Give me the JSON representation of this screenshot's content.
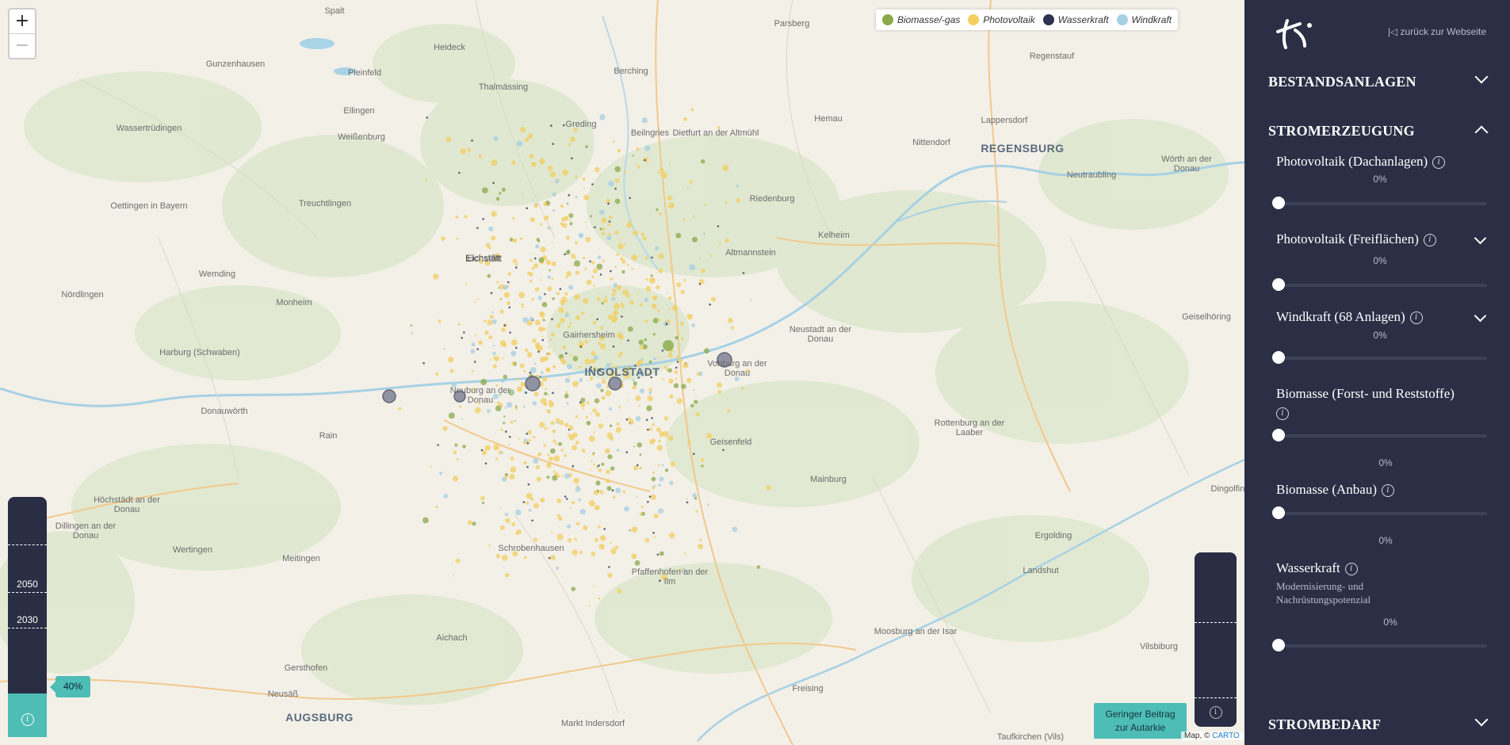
{
  "map": {
    "zoom_in": "+",
    "zoom_out": "−",
    "places": [
      {
        "name": "Spalt",
        "cls": ""
      },
      {
        "name": "Heideck",
        "cls": ""
      },
      {
        "name": "Gunzenhausen",
        "cls": ""
      },
      {
        "name": "Pleinfeld",
        "cls": ""
      },
      {
        "name": "Berching",
        "cls": ""
      },
      {
        "name": "Parsberg",
        "cls": ""
      },
      {
        "name": "Regenstauf",
        "cls": ""
      },
      {
        "name": "Thalmässing",
        "cls": ""
      },
      {
        "name": "Ellingen",
        "cls": ""
      },
      {
        "name": "Wassertrüdingen",
        "cls": ""
      },
      {
        "name": "Greding",
        "cls": ""
      },
      {
        "name": "Beilngries",
        "cls": ""
      },
      {
        "name": "Dietfurt an der Altmühl",
        "cls": ""
      },
      {
        "name": "Hemau",
        "cls": ""
      },
      {
        "name": "Lappersdorf",
        "cls": ""
      },
      {
        "name": "Weißenburg",
        "cls": ""
      },
      {
        "name": "Nittendorf",
        "cls": ""
      },
      {
        "name": "REGENSBURG",
        "cls": "city"
      },
      {
        "name": "Wörth an der Donau",
        "cls": ""
      },
      {
        "name": "Neutraubling",
        "cls": ""
      },
      {
        "name": "Riedenburg",
        "cls": ""
      },
      {
        "name": "Oettingen in Bayern",
        "cls": ""
      },
      {
        "name": "Treuchtlingen",
        "cls": ""
      },
      {
        "name": "Eichstätt",
        "cls": "mid"
      },
      {
        "name": "Kelheim",
        "cls": ""
      },
      {
        "name": "Altmannstein",
        "cls": ""
      },
      {
        "name": "Wemding",
        "cls": ""
      },
      {
        "name": "Nördlingen",
        "cls": ""
      },
      {
        "name": "Monheim",
        "cls": ""
      },
      {
        "name": "Geiselhöring",
        "cls": ""
      },
      {
        "name": "Gaimersheim",
        "cls": ""
      },
      {
        "name": "Neustadt an der Donau",
        "cls": ""
      },
      {
        "name": "Harburg (Schwaben)",
        "cls": ""
      },
      {
        "name": "INGOLSTADT",
        "cls": "city"
      },
      {
        "name": "Vohburg an der Donau",
        "cls": ""
      },
      {
        "name": "Neuburg an der Donau",
        "cls": ""
      },
      {
        "name": "Donauwörth",
        "cls": ""
      },
      {
        "name": "Rain",
        "cls": ""
      },
      {
        "name": "Rottenburg an der Laaber",
        "cls": ""
      },
      {
        "name": "Geisenfeld",
        "cls": ""
      },
      {
        "name": "Mainburg",
        "cls": ""
      },
      {
        "name": "Höchstädt an der Donau",
        "cls": ""
      },
      {
        "name": "Dillingen an der Donau",
        "cls": ""
      },
      {
        "name": "Ergolding",
        "cls": ""
      },
      {
        "name": "Wertingen",
        "cls": ""
      },
      {
        "name": "Schrobenhausen",
        "cls": ""
      },
      {
        "name": "Meitingen",
        "cls": ""
      },
      {
        "name": "Landshut",
        "cls": ""
      },
      {
        "name": "Pfaffenhofen an der Ilm",
        "cls": ""
      },
      {
        "name": "Aichach",
        "cls": ""
      },
      {
        "name": "Moosburg an der Isar",
        "cls": ""
      },
      {
        "name": "Vilsbiburg",
        "cls": ""
      },
      {
        "name": "Gersthofen",
        "cls": ""
      },
      {
        "name": "Freising",
        "cls": ""
      },
      {
        "name": "Neusäß",
        "cls": ""
      },
      {
        "name": "AUGSBURG",
        "cls": "city"
      },
      {
        "name": "Markt Indersdorf",
        "cls": ""
      },
      {
        "name": "Taufkirchen (Vils)",
        "cls": ""
      },
      {
        "name": "Dingolfing",
        "cls": ""
      },
      {
        "name": "Eichstätt",
        "cls": ""
      }
    ]
  },
  "legend": {
    "items": [
      {
        "label": "Biomasse/-gas",
        "color": "#8aaa4a"
      },
      {
        "label": "Photovoltaik",
        "color": "#f2cf60"
      },
      {
        "label": "Wasserkraft",
        "color": "#2b3350"
      },
      {
        "label": "Windkraft",
        "color": "#a7cfe2"
      }
    ]
  },
  "left_gauge": {
    "year_2050": "2050",
    "year_2030": "2030",
    "level_pct": "40%",
    "fill_fraction": 0.18,
    "info": "i"
  },
  "right_gauge": {
    "info": "i",
    "button_line1": "Geringer Beitrag",
    "button_line2": "zur Autarkie"
  },
  "attribution": {
    "text": "Map, © ",
    "link": "CARTO"
  },
  "panel": {
    "back_link": "zurück zur Webseite",
    "sections": {
      "bestand": "BESTANDSANLAGEN",
      "strom": "STROMERZEUGUNG",
      "bedarf": "STROMBEDARF"
    },
    "rows": [
      {
        "title": "Photovoltaik (Dachanlagen)",
        "pct": "0%"
      },
      {
        "title": "Photovoltaik (Freiflächen)",
        "pct": "0%"
      },
      {
        "title": "Windkraft (68 Anlagen)",
        "pct": "0%"
      },
      {
        "title": "Biomasse (Forst- und Reststoffe)",
        "pct": "0%"
      },
      {
        "title": "Biomasse (Anbau)",
        "pct": "0%"
      },
      {
        "title": "Wasserkraft",
        "pct": "0%",
        "subtitle": "Modernisierung- und Nachrüstungspotenzial"
      }
    ],
    "info_glyph": "i"
  },
  "colors": {
    "panel_bg": "#2b2f45",
    "accent": "#4dbdb5"
  }
}
